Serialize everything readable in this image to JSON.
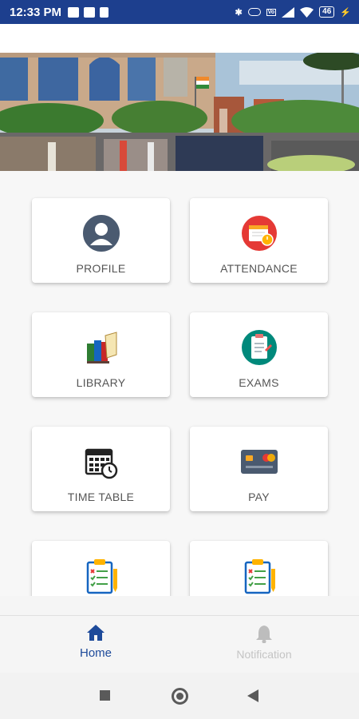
{
  "status_bar": {
    "time": "12:33 PM",
    "battery": "46",
    "left_icons": [
      "message-icon",
      "sim-icon",
      "delete-icon"
    ],
    "right_icons": [
      "bluetooth-icon",
      "vibrate-icon",
      "volte-icon",
      "signal-icon",
      "wifi-icon",
      "battery-icon",
      "charging-icon"
    ]
  },
  "tiles": [
    {
      "label": "PROFILE",
      "icon": "profile-icon"
    },
    {
      "label": "ATTENDANCE",
      "icon": "attendance-icon"
    },
    {
      "label": "LIBRARY",
      "icon": "library-icon"
    },
    {
      "label": "EXAMS",
      "icon": "exams-icon"
    },
    {
      "label": "TIME TABLE",
      "icon": "timetable-icon"
    },
    {
      "label": "PAY",
      "icon": "pay-icon"
    },
    {
      "label": "",
      "icon": "checklist-icon"
    },
    {
      "label": "",
      "icon": "checklist-icon"
    }
  ],
  "bottom_nav": {
    "home": "Home",
    "notification": "Notification",
    "active_color": "#1d4a9a",
    "inactive_color": "#bdbdbd"
  },
  "colors": {
    "status_bar": "#1d3f8e",
    "attendance_red": "#e53935",
    "profile_slate": "#4a5a70"
  }
}
